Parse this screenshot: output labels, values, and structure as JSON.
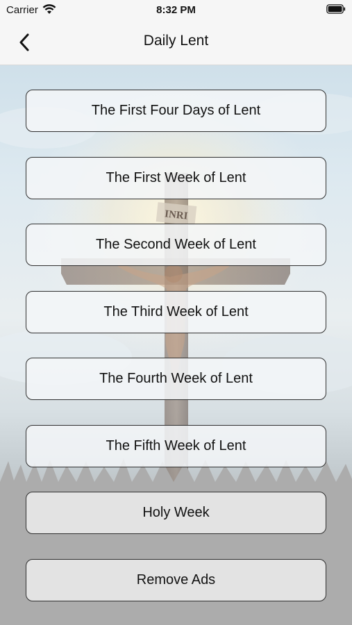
{
  "status_bar": {
    "carrier": "Carrier",
    "time": "8:32 PM",
    "icons": [
      "wifi-icon",
      "battery-icon"
    ]
  },
  "nav_bar": {
    "title": "Daily Lent",
    "back_icon": "chevron-left-icon"
  },
  "background": {
    "image": "crucifix-with-clouds-and-sunlight",
    "cross_inscription": "INRI"
  },
  "menu": {
    "items": [
      {
        "label": "The First Four Days of Lent"
      },
      {
        "label": "The First Week of Lent"
      },
      {
        "label": "The Second Week of Lent"
      },
      {
        "label": "The Third Week of Lent"
      },
      {
        "label": "The Fourth Week of Lent"
      },
      {
        "label": "The Fifth Week of Lent"
      },
      {
        "label": "Holy Week"
      },
      {
        "label": "Remove Ads"
      }
    ]
  },
  "colors": {
    "bar_background": "#f6f6f6",
    "button_border": "#2f2f2f",
    "button_fill": "#f3f6f8",
    "button_fill_gray": "#e3e3e3"
  }
}
